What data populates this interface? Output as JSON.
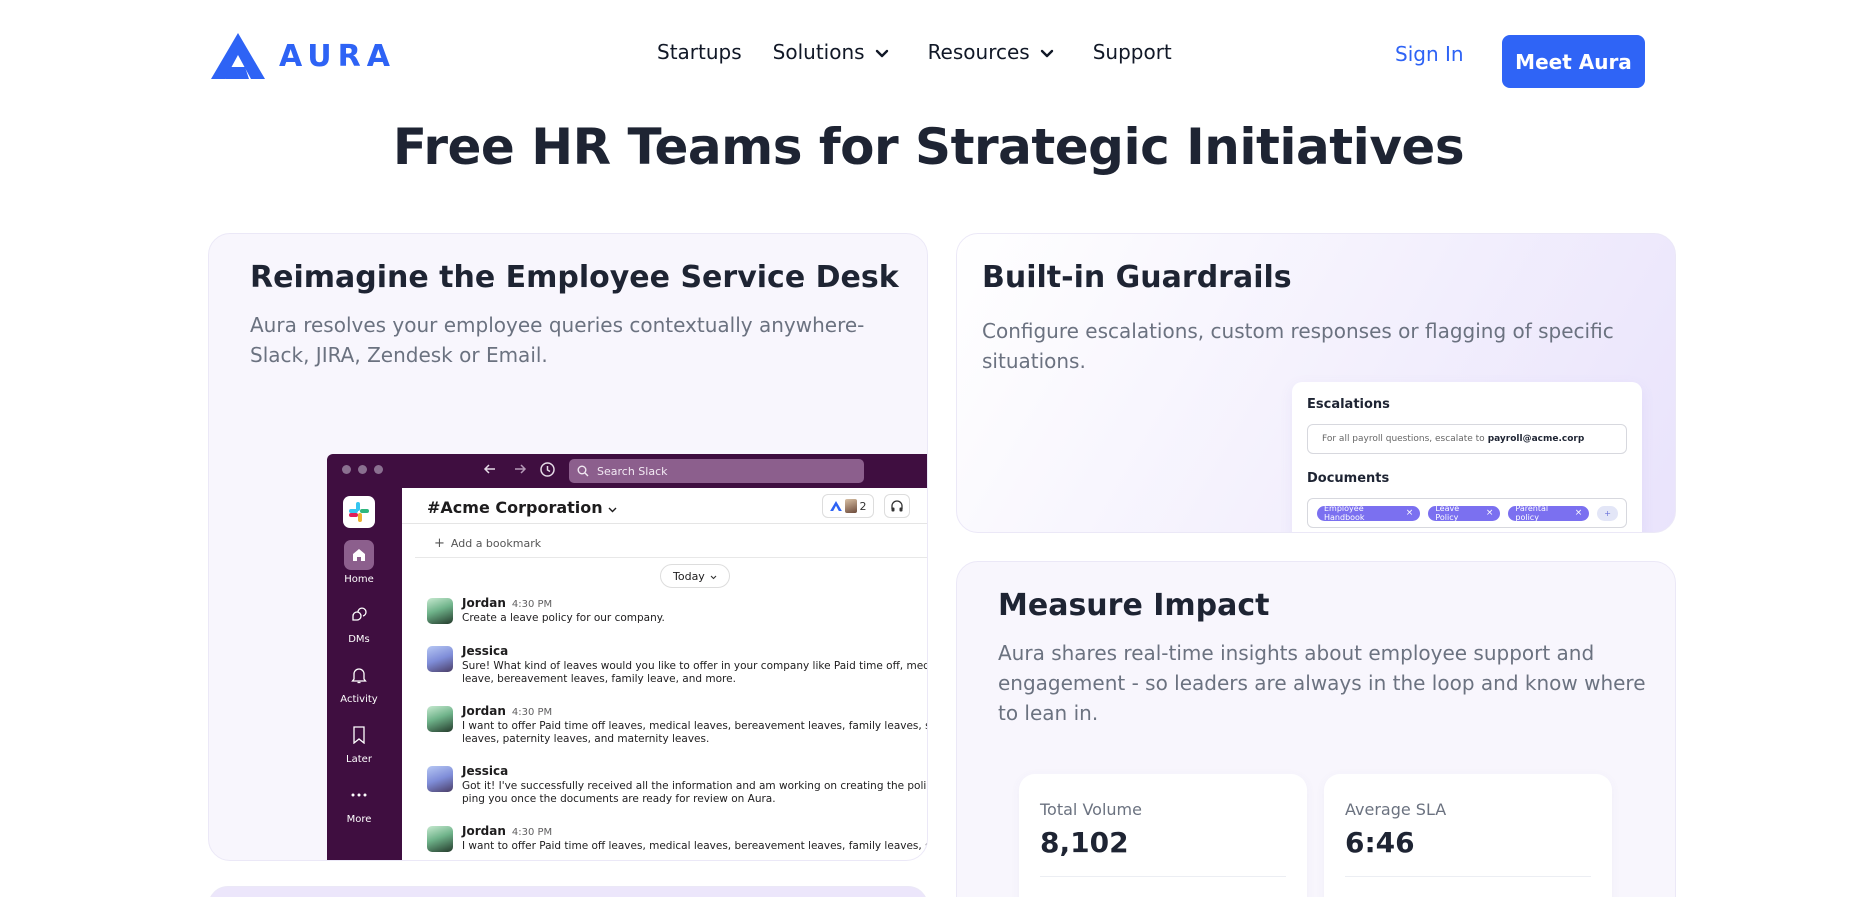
{
  "brand": {
    "name": "AURA",
    "accent": "#2e63f5"
  },
  "nav": {
    "links": [
      {
        "label": "Startups",
        "dropdown": false
      },
      {
        "label": "Solutions",
        "dropdown": true
      },
      {
        "label": "Resources",
        "dropdown": true
      },
      {
        "label": "Support",
        "dropdown": false
      }
    ],
    "sign_in": "Sign In",
    "cta": "Meet Aura"
  },
  "hero": {
    "title": "Free HR Teams for Strategic Initiatives"
  },
  "cards": {
    "service_desk": {
      "title": "Reimagine the Employee Service Desk",
      "desc_line1": "Aura resolves your employee queries contextually anywhere-",
      "desc_line2": "Slack, JIRA, Zendesk or Email."
    },
    "guardrails": {
      "title": "Built-in Guardrails",
      "desc_line1": "Configure escalations, custom responses or flagging of specific",
      "desc_line2": "situations."
    },
    "impact": {
      "title": "Measure Impact",
      "desc_line1": "Aura shares real-time insights about employee support and",
      "desc_line2": "engagement - so leaders are always in the loop and know where",
      "desc_line3": "to lean in."
    }
  },
  "slack": {
    "search_placeholder": "Search Slack",
    "channel": "#Acme Corporation",
    "member_count": "2",
    "add_bookmark": "Add a bookmark",
    "date_divider": "Today",
    "sidebar": [
      {
        "label": "Home",
        "icon": "home-icon"
      },
      {
        "label": "DMs",
        "icon": "dms-icon"
      },
      {
        "label": "Activity",
        "icon": "bell-icon"
      },
      {
        "label": "Later",
        "icon": "bookmark-icon"
      },
      {
        "label": "More",
        "icon": "more-icon"
      }
    ],
    "messages": [
      {
        "author": "Jordan",
        "time": "4:30 PM",
        "line1": "Create a leave policy for our company.",
        "line2": ""
      },
      {
        "author": "Jessica",
        "time": "",
        "line1": "Sure! What kind of leaves would you like to offer in your company like Paid time off, medica",
        "line2": "leave, bereavement leaves, family leave, and more."
      },
      {
        "author": "Jordan",
        "time": "4:30 PM",
        "line1": "I want to offer Paid time off leaves, medical leaves, bereavement leaves, family leaves, sick",
        "line2": "leaves, paternity leaves, and maternity leaves."
      },
      {
        "author": "Jessica",
        "time": "",
        "line1": "Got it! I've successfully received all the information and am working on creating the policy. I",
        "line2": "ping you once the documents are ready for review on Aura."
      },
      {
        "author": "Jordan",
        "time": "4:30 PM",
        "line1": "I want to offer Paid time off leaves, medical leaves, bereavement leaves, family leaves, sick",
        "line2": ""
      }
    ]
  },
  "guardrails_mock": {
    "escalations_label": "Escalations",
    "escalation_text": "For all payroll questions, escalate to",
    "escalation_email": "payroll@acme.corp",
    "documents_label": "Documents",
    "chips": [
      "Employee Handbook",
      "Leave Policy",
      "Parental policy"
    ],
    "add_chip": "+"
  },
  "metrics": [
    {
      "label": "Total Volume",
      "value": "8,102"
    },
    {
      "label": "Average SLA",
      "value": "6:46"
    }
  ]
}
